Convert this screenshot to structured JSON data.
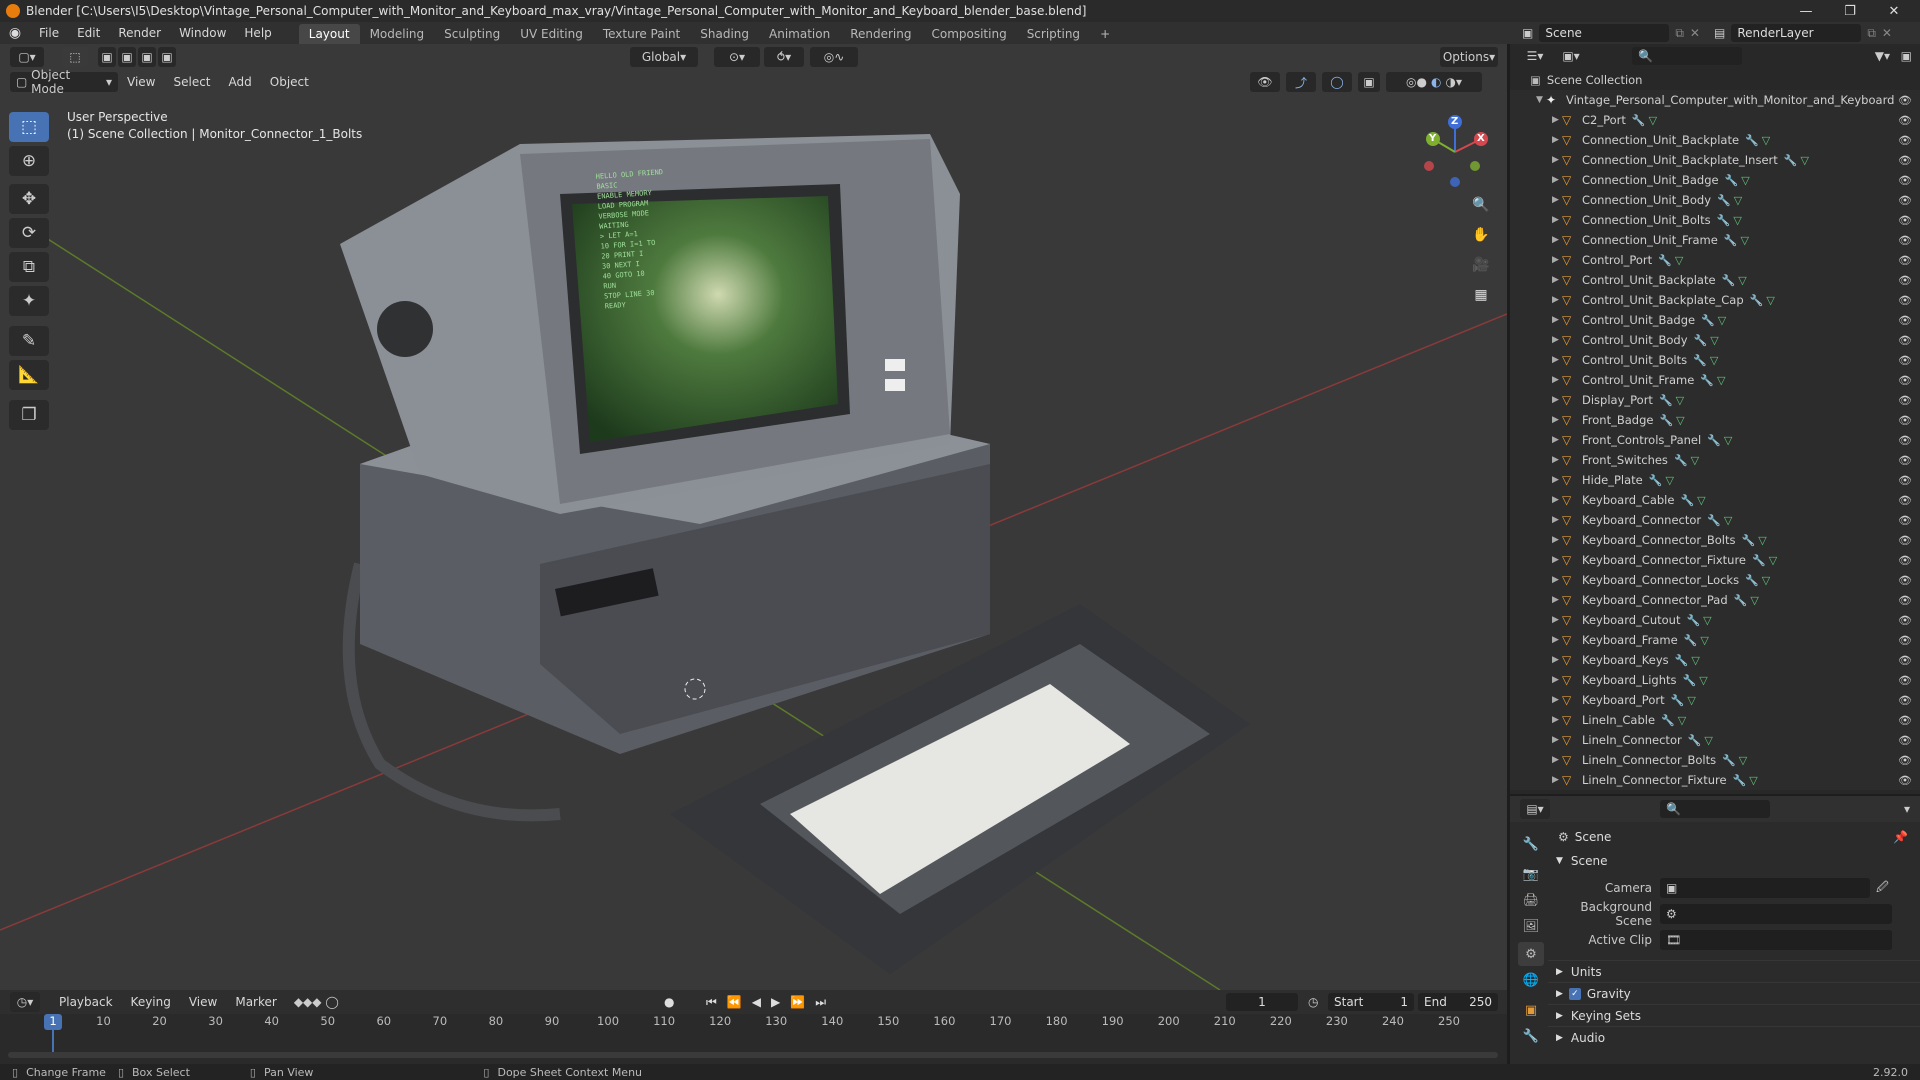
{
  "window": {
    "title": "Blender [C:\\Users\\I5\\Desktop\\Vintage_Personal_Computer_with_Monitor_and_Keyboard_max_vray/Vintage_Personal_Computer_with_Monitor_and_Keyboard_blender_base.blend]"
  },
  "menu": {
    "items": [
      "File",
      "Edit",
      "Render",
      "Window",
      "Help"
    ],
    "workspaces": [
      "Layout",
      "Modeling",
      "Sculpting",
      "UV Editing",
      "Texture Paint",
      "Shading",
      "Animation",
      "Rendering",
      "Compositing",
      "Scripting"
    ],
    "add_workspace": "+",
    "scene_label": "Scene",
    "render_layer_label": "RenderLayer"
  },
  "viewport": {
    "mode": "Object Mode",
    "menus": [
      "View",
      "Select",
      "Add",
      "Object"
    ],
    "transform_orientation": "Global",
    "options": "Options",
    "overlay_line1": "User Perspective",
    "overlay_line2": "(1) Scene Collection | Monitor_Connector_1_Bolts",
    "gizmo": {
      "x": "X",
      "y": "Y",
      "z": "Z"
    },
    "screen_lines": [
      "HELLO OLD FRIEND",
      "",
      "BASIC",
      "ENABLE MEMORY",
      "LOAD PROGRAM",
      "VERBOSE MODE",
      "",
      "WAITING",
      "> LET A=1",
      "10 FOR I=1 TO",
      "20 PRINT I",
      "30 NEXT I",
      "40 GOTO 10",
      "RUN",
      "",
      "STOP LINE 30",
      "READY"
    ]
  },
  "outliner": {
    "root": "Scene Collection",
    "collection": "Vintage_Personal_Computer_with_Monitor_and_Keyboard",
    "objects": [
      "C2_Port",
      "Connection_Unit_Backplate",
      "Connection_Unit_Backplate_Insert",
      "Connection_Unit_Badge",
      "Connection_Unit_Body",
      "Connection_Unit_Bolts",
      "Connection_Unit_Frame",
      "Control_Port",
      "Control_Unit_Backplate",
      "Control_Unit_Backplate_Cap",
      "Control_Unit_Badge",
      "Control_Unit_Body",
      "Control_Unit_Bolts",
      "Control_Unit_Frame",
      "Display_Port",
      "Front_Badge",
      "Front_Controls_Panel",
      "Front_Switches",
      "Hide_Plate",
      "Keyboard_Cable",
      "Keyboard_Connector",
      "Keyboard_Connector_Bolts",
      "Keyboard_Connector_Fixture",
      "Keyboard_Connector_Locks",
      "Keyboard_Connector_Pad",
      "Keyboard_Cutout",
      "Keyboard_Frame",
      "Keyboard_Keys",
      "Keyboard_Lights",
      "Keyboard_Port",
      "LineIn_Cable",
      "LineIn_Connector",
      "LineIn_Connector_Bolts",
      "LineIn_Connector_Fixture"
    ]
  },
  "properties": {
    "context": "Scene",
    "panel_scene": "Scene",
    "camera_label": "Camera",
    "background_scene_label": "Background Scene",
    "active_clip_label": "Active Clip",
    "sub_panels": [
      "Units",
      "Gravity",
      "Keying Sets",
      "Audio"
    ],
    "gravity_checked": true
  },
  "timeline": {
    "menus": [
      "Playback",
      "Keying",
      "View",
      "Marker"
    ],
    "current_frame": "1",
    "start_label": "Start",
    "start": "1",
    "end_label": "End",
    "end": "250",
    "ticks": [
      "1",
      "10",
      "20",
      "30",
      "40",
      "50",
      "60",
      "70",
      "80",
      "90",
      "100",
      "110",
      "120",
      "130",
      "140",
      "150",
      "160",
      "170",
      "180",
      "190",
      "200",
      "210",
      "220",
      "230",
      "240",
      "250"
    ]
  },
  "status": {
    "items": [
      "Change Frame",
      "Box Select",
      "Pan View",
      "Dope Sheet Context Menu"
    ],
    "version": "2.92.0"
  }
}
